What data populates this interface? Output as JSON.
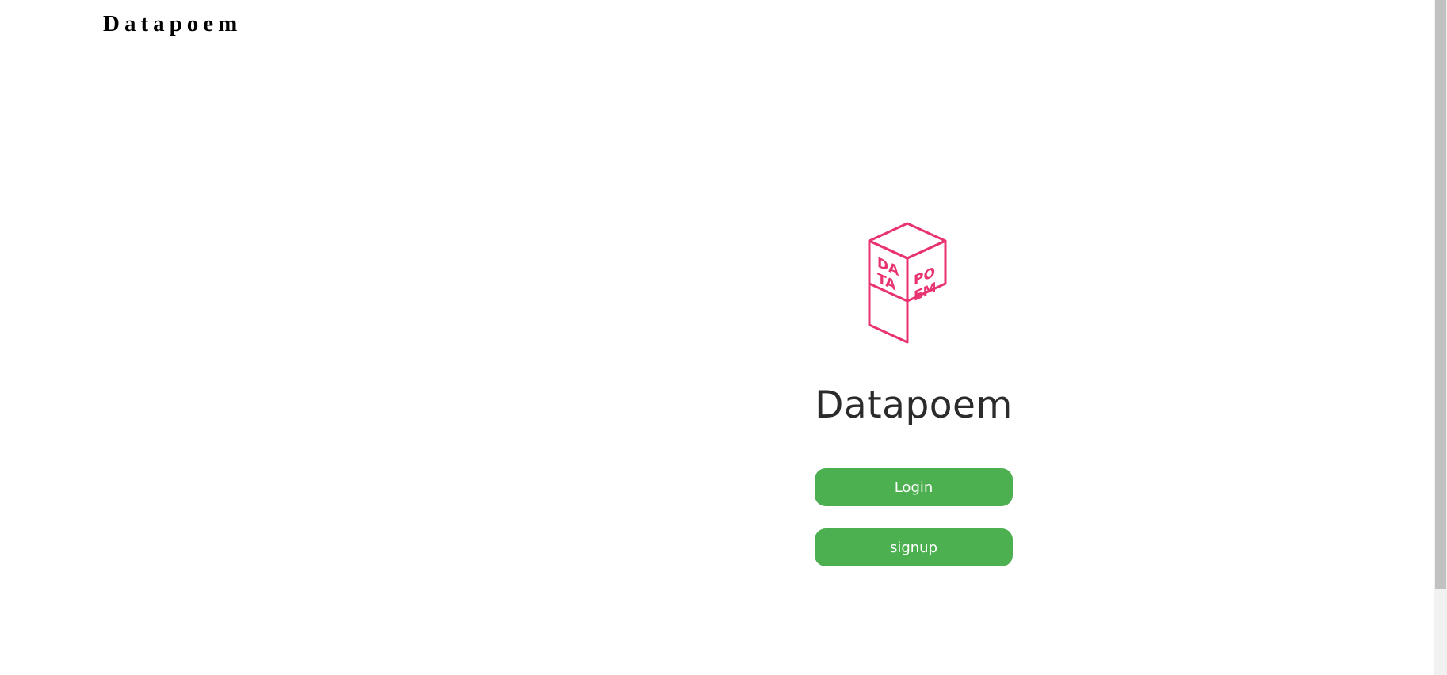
{
  "header": {
    "brand": "Datapoem"
  },
  "main": {
    "logo_icon": "datapoem-cube-logo",
    "logo_text": [
      "DA",
      "TA",
      "PO",
      "EM"
    ],
    "app_name": "Datapoem",
    "login_label": "Login",
    "signup_label": "signup"
  },
  "colors": {
    "accent": "#4caf50",
    "logo": "#e8336f",
    "text": "#2b2b2b"
  }
}
